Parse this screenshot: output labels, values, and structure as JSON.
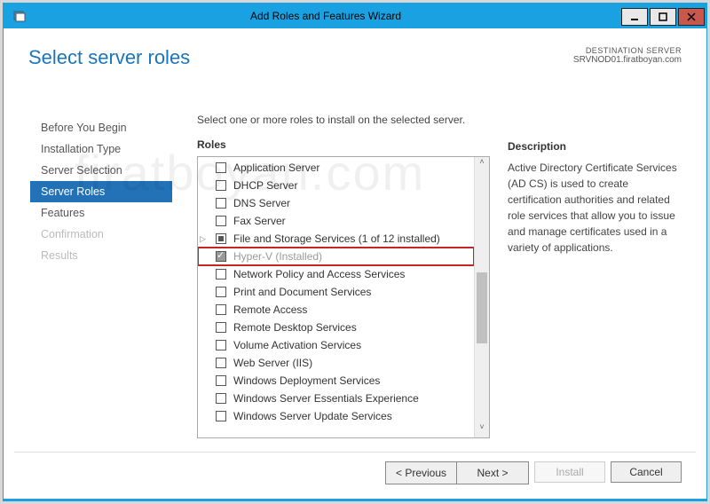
{
  "window": {
    "title": "Add Roles and Features Wizard"
  },
  "page": {
    "title": "Select server roles",
    "destination_label": "DESTINATION SERVER",
    "destination_server": "SRVNOD01.firatboyan.com",
    "instruction": "Select one or more roles to install on the selected server."
  },
  "nav": [
    {
      "label": "Before You Begin",
      "state": "normal"
    },
    {
      "label": "Installation Type",
      "state": "normal"
    },
    {
      "label": "Server Selection",
      "state": "normal"
    },
    {
      "label": "Server Roles",
      "state": "selected"
    },
    {
      "label": "Features",
      "state": "normal"
    },
    {
      "label": "Confirmation",
      "state": "disabled"
    },
    {
      "label": "Results",
      "state": "disabled"
    }
  ],
  "headers": {
    "roles": "Roles",
    "description": "Description"
  },
  "roles": [
    {
      "label": "Application Server",
      "checked": false
    },
    {
      "label": "DHCP Server",
      "checked": false
    },
    {
      "label": "DNS Server",
      "checked": false
    },
    {
      "label": "Fax Server",
      "checked": false
    },
    {
      "label": "File and Storage Services (1 of 12 installed)",
      "checked": false,
      "mixed": true,
      "expandable": true
    },
    {
      "label": "Hyper-V (Installed)",
      "checked": true,
      "installed": true,
      "highlight": true
    },
    {
      "label": "Network Policy and Access Services",
      "checked": false
    },
    {
      "label": "Print and Document Services",
      "checked": false
    },
    {
      "label": "Remote Access",
      "checked": false
    },
    {
      "label": "Remote Desktop Services",
      "checked": false
    },
    {
      "label": "Volume Activation Services",
      "checked": false
    },
    {
      "label": "Web Server (IIS)",
      "checked": false
    },
    {
      "label": "Windows Deployment Services",
      "checked": false
    },
    {
      "label": "Windows Server Essentials Experience",
      "checked": false
    },
    {
      "label": "Windows Server Update Services",
      "checked": false
    }
  ],
  "description": "Active Directory Certificate Services (AD CS) is used to create certification authorities and related role services that allow you to issue and manage certificates used in a variety of applications.",
  "buttons": {
    "previous": "< Previous",
    "next": "Next >",
    "install": "Install",
    "cancel": "Cancel"
  },
  "watermark": "firatboyan.com"
}
